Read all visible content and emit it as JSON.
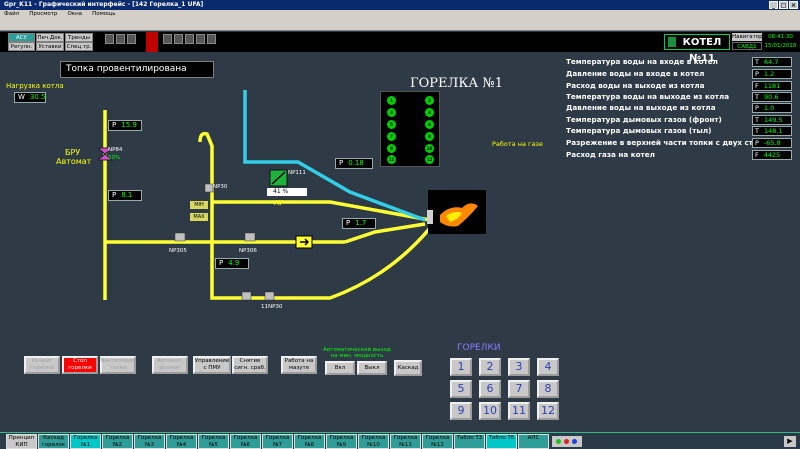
{
  "window": {
    "title": "Gpr_K11 - Графический интерфейс - [142 Горелка_1 UFA]",
    "menu": [
      "Файл",
      "Просмотр",
      "Окна",
      "Помощь"
    ]
  },
  "topnav": {
    "row1": [
      "АСУ",
      "Печ.Док.",
      "Тренды"
    ],
    "row2": [
      "Регулн.",
      "Уставки",
      "Спец.тр."
    ]
  },
  "header": {
    "boiler": "КОТЕЛ №11",
    "nav_label": "Навигатор",
    "user": "САВД1",
    "time": "08:41:30",
    "date": "15/01/2018"
  },
  "status": "Топка провентилирована",
  "boiler_load": {
    "label": "Нагрузка котла",
    "key": "W",
    "value": "30.5"
  },
  "bru": {
    "label1": "БРУ",
    "label2": "Автомат",
    "valve": "NP84",
    "percent": "50%"
  },
  "values": {
    "p1": {
      "key": "P",
      "value": "15.9"
    },
    "p2": {
      "key": "P",
      "value": "8.1"
    },
    "p3": {
      "key": "P",
      "value": "0.18"
    },
    "p4": {
      "key": "P",
      "value": "1.7"
    },
    "p5": {
      "key": "P",
      "value": "4.9"
    }
  },
  "valves": {
    "np30": "NP30",
    "np111": "NP111",
    "np305": "NP305",
    "np306": "NP306",
    "np1130": "11NP30",
    "au": "АУ",
    "au_pct": "41 %",
    "min": "МІН",
    "max": "МАХ"
  },
  "burner": {
    "title": "ГОРЕЛКА №1",
    "work": "Работа на газе",
    "leds_left": [
      "1",
      "3",
      "5",
      "7",
      "9",
      "11"
    ],
    "leds_right": [
      "2",
      "4",
      "6",
      "8",
      "10",
      "12"
    ]
  },
  "readings": [
    {
      "label": "Температура воды на входе в котел",
      "key": "T",
      "value": "64.7"
    },
    {
      "label": "Давление воды на входе в котел",
      "key": "P",
      "value": "1.2"
    },
    {
      "label": "Расход воды на выходе из котла",
      "key": "F",
      "value": "1181"
    },
    {
      "label": "Температура воды на выходе из котла",
      "key": "T",
      "value": "90.6"
    },
    {
      "label": "Давление воды на выходе из котла",
      "key": "P",
      "value": "1.0"
    },
    {
      "label": "Температура дымовых газов (фронт)",
      "key": "T",
      "value": "149.5"
    },
    {
      "label": "Температура дымовых газов (тыл)",
      "key": "T",
      "value": "148.1"
    },
    {
      "label": "Разрежение в верхней части топки с двух стор",
      "key": "P",
      "value": "-65.8"
    },
    {
      "label": "Расход газа на котел",
      "key": "F",
      "value": "4425"
    }
  ],
  "controls": {
    "b1": "Разжиг горелки",
    "b2": "Стоп горелки",
    "b3": "Вентиляция топки",
    "b4": "Автомат. розжиг",
    "b5": "Управление с ПМУ",
    "b6": "Снятие сигн. сраб.",
    "b7": "Работа на мазуте",
    "auto_title": "Автоматический выход на мин. мощность",
    "on": "Вкл",
    "off": "Выкл",
    "cascade": "Каскад"
  },
  "burners": {
    "title": "ГОРЕЛКИ",
    "numbers": [
      "1",
      "2",
      "3",
      "4",
      "5",
      "6",
      "7",
      "8",
      "9",
      "10",
      "11",
      "12"
    ]
  },
  "taskbar": [
    "Принцип КИП",
    "Каскад горелок",
    "Горелка №1",
    "Горелка №2",
    "Горелка №3",
    "Горелка №4",
    "Горелка №5",
    "Горелка №6",
    "Горелка №7",
    "Горелка №8",
    "Горелка №9",
    "Горелка №10",
    "Горелка №11",
    "Горелка №12",
    "Табло Т3",
    "Табло Т6",
    "АПС"
  ]
}
